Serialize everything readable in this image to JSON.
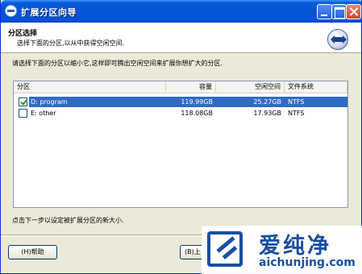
{
  "window": {
    "title": "扩展分区向导"
  },
  "header": {
    "title": "分区选择",
    "subtitle": "选择下面的分区,以从中获得空闲空间."
  },
  "instruction": "请选择下面的分区以缩小它,这样即可腾出空闲空间来扩展你想扩大的分区.",
  "list": {
    "columns": [
      "分区",
      "容量",
      "空闲空间",
      "文件系统"
    ],
    "rows": [
      {
        "name": "D: program",
        "capacity": "119.99GB",
        "free": "25.27GB",
        "fs": "NTFS",
        "checked": true,
        "selected": true
      },
      {
        "name": "E: other",
        "capacity": "118.08GB",
        "free": "17.93GB",
        "fs": "NTFS",
        "checked": false,
        "selected": false
      }
    ]
  },
  "footer_note": "点击下一步以设定被扩展分区的新大小.",
  "buttons": {
    "help": "(H)帮助",
    "prev": "(B)上"
  },
  "watermark": {
    "text_cn": "爱纯净",
    "url": "aichunjing.com"
  },
  "colors": {
    "selection": "#316ac5",
    "titlebar": "#0653d6",
    "watermark": "#1a4fa0"
  }
}
